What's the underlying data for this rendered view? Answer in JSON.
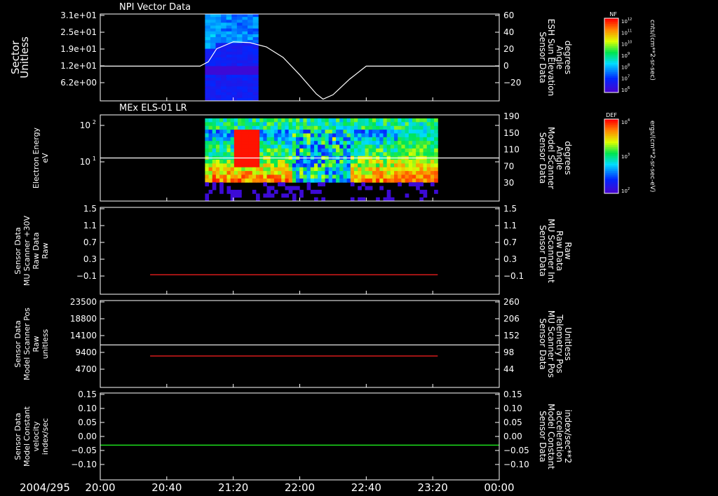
{
  "date_label": "2004/295",
  "time_axis": {
    "start": "20:00",
    "end": "00:00",
    "ticks": [
      "20:00",
      "20:40",
      "21:20",
      "22:00",
      "22:40",
      "23:20",
      "00:00"
    ]
  },
  "chart_data": [
    {
      "type": "heatmap",
      "title": "NPI Vector Data",
      "ylabel": [
        "Sector",
        "Unitless"
      ],
      "yticks": [
        "3.1e+01",
        "2.5e+01",
        "1.9e+01",
        "1.2e+01",
        "6.2e+00"
      ],
      "y2label": [
        "Sensor Data",
        "ESH Sun Elevation",
        "Angle",
        "degrees"
      ],
      "y2ticks": [
        "60",
        "40",
        "20",
        "0",
        "−20"
      ],
      "y2lim": [
        -40,
        60
      ],
      "spectrogram_window": [
        "21:03",
        "21:35"
      ],
      "colorbar": {
        "label": "NF",
        "unit": "cnts/(cm**2-sr-sec)",
        "ticks": [
          "10",
          "10",
          "10",
          "10",
          "10",
          "10",
          "10"
        ],
        "exponents": [
          "12",
          "11",
          "10",
          "9",
          "8",
          "7",
          "6"
        ]
      },
      "series": [
        {
          "color": "#ffffff",
          "x": [
            "20:00",
            "21:00",
            "21:05",
            "21:10",
            "21:20",
            "21:30",
            "21:40",
            "21:50",
            "22:00",
            "22:10",
            "22:14",
            "22:20",
            "22:30",
            "22:40",
            "23:00",
            "23:30",
            "00:00"
          ],
          "y": [
            0,
            0,
            5,
            20,
            28,
            27,
            22,
            10,
            -10,
            -32,
            -38,
            -33,
            -15,
            0,
            0,
            0,
            0
          ]
        }
      ]
    },
    {
      "type": "heatmap",
      "title": "MEx ELS-01 LR",
      "ylabel": [
        "Electron Energy",
        "eV"
      ],
      "yticks": [
        "10",
        "10"
      ],
      "yexponents": [
        "2",
        "1"
      ],
      "y2label": [
        "Sensor Data",
        "Model Scanner",
        "Angle",
        "degrees"
      ],
      "y2ticks": [
        "190",
        "150",
        "110",
        "70",
        "30"
      ],
      "y2lim": [
        0,
        190
      ],
      "spectrogram_window": [
        "21:03",
        "23:23"
      ],
      "colorbar": {
        "label": "DEF",
        "unit": "ergs/(cm**2-sr-sec-eV)",
        "ticks": [
          "10",
          "10",
          "10"
        ],
        "exponents": [
          "4",
          "3",
          "2"
        ]
      },
      "series": [
        {
          "color": "#ffffff",
          "x": [
            "20:00",
            "00:00"
          ],
          "y": [
            95,
            95
          ]
        }
      ]
    },
    {
      "type": "line",
      "ylabel": [
        "Sensor Data",
        "MU Scanner +30V",
        "Raw Data",
        "Raw"
      ],
      "yticks": [
        "1.5",
        "1.1",
        "0.7",
        "0.3",
        "−0.1"
      ],
      "ylim": [
        -0.5,
        1.5
      ],
      "y2label": [
        "Sensor Data",
        "MU Scanner Int",
        "Raw Data",
        "Raw"
      ],
      "y2ticks": [
        "1.5",
        "1.1",
        "0.7",
        "0.3",
        "−0.1"
      ],
      "series": [
        {
          "color": "#ff2020",
          "x": [
            "20:30",
            "23:23"
          ],
          "y": [
            -0.05,
            -0.05
          ]
        }
      ]
    },
    {
      "type": "line",
      "ylabel": [
        "Sensor Data",
        "Model Scanner Pos",
        "Raw",
        "unitless"
      ],
      "yticks": [
        "23500",
        "18800",
        "14100",
        "9400",
        "4700"
      ],
      "ylim": [
        0,
        23500
      ],
      "y2label": [
        "Sensor Data",
        "MU Scanner Pos",
        "Telemetry Pos",
        "Unitless"
      ],
      "y2ticks": [
        "260",
        "206",
        "152",
        "98",
        "44"
      ],
      "y2lim": [
        0,
        260
      ],
      "series": [
        {
          "color": "#ffffff",
          "x": [
            "20:00",
            "00:00"
          ],
          "y": [
            11500,
            11500
          ]
        },
        {
          "color": "#ff2020",
          "x": [
            "20:30",
            "23:23"
          ],
          "y": [
            8500,
            8500
          ]
        }
      ]
    },
    {
      "type": "line",
      "ylabel": [
        "Sensor Data",
        "Model Constant",
        "velocity",
        "index/sec"
      ],
      "yticks": [
        "0.15",
        "0.10",
        "0.05",
        "0.00",
        "−0.05",
        "−0.10"
      ],
      "ylim": [
        -0.1,
        0.15
      ],
      "y2label": [
        "Sensor Data",
        "Model Constant",
        "acceleration",
        "index/sec**2"
      ],
      "y2ticks": [
        "0.15",
        "0.10",
        "0.05",
        "0.00",
        "−0.05",
        "−0.10"
      ],
      "series": [
        {
          "color": "#20ff20",
          "x": [
            "20:00",
            "00:00"
          ],
          "y": [
            0.0,
            0.0
          ]
        }
      ]
    }
  ]
}
